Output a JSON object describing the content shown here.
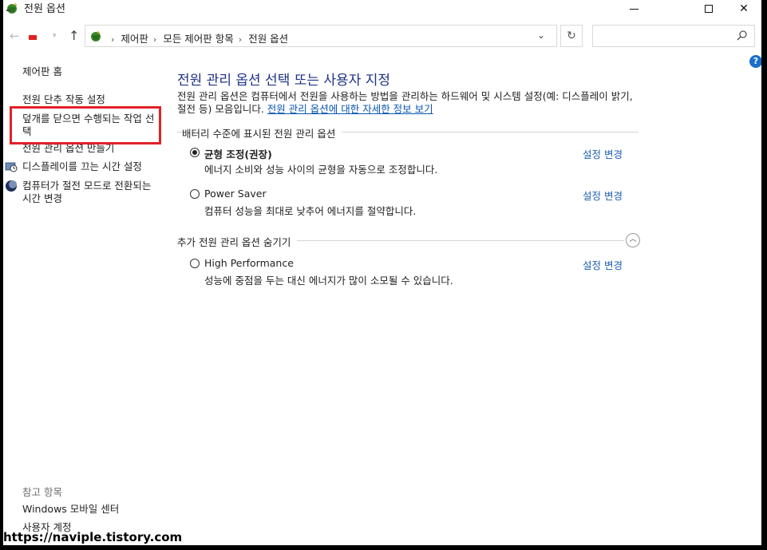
{
  "window": {
    "title": "전원 옵션"
  },
  "address_bar": {
    "crumbs": [
      "제어판",
      "모든 제어판 항목",
      "전원 옵션"
    ],
    "search_placeholder": ""
  },
  "sidebar": {
    "home": "제어판 홈",
    "power_button": "전원 단추 작동 설정",
    "lid_close": "덮개를 닫으면 수행되는 작업 선택",
    "create_plan": "전원 관리 옵션 만들기",
    "display_off": "디스플레이를 끄는 시간 설정",
    "sleep_change": "컴퓨터가 절전 모드로 전환되는 시간 변경",
    "see_also": "참고 항목",
    "mobility_center": "Windows 모바일 센터",
    "user_accounts": "사용자 계정"
  },
  "main": {
    "title": "전원 관리 옵션 선택 또는 사용자 지정",
    "description": "전원 관리 옵션은 컴퓨터에서 전원을 사용하는 방법을 관리하는 하드웨어 및 시스템 설정(예: 디스플레이 밝기, 절전 등) 모음입니다.",
    "more_info_link": "전원 관리 옵션에 대한 자세한 정보 보기",
    "battery_group": "배터리 수준에 표시된 전원 관리 옵션",
    "hidden_group": "추가 전원 관리 옵션 숨기기",
    "change_label": "설정 변경",
    "plans": [
      {
        "name": "균형 조정(권장)",
        "desc": "에너지 소비와 성능 사이의 균형을 자동으로 조정합니다.",
        "selected": true
      },
      {
        "name": "Power Saver",
        "desc": "컴퓨터 성능을 최대로 낮추어 에너지를 절약합니다.",
        "selected": false
      },
      {
        "name": "High Performance",
        "desc": "성능에 중점을 두는 대신 에너지가 많이 소모될 수 있습니다.",
        "selected": false
      }
    ]
  },
  "watermark": "https://naviple.tistory.com",
  "colors": {
    "title_blue": "#1e3287",
    "link_blue": "#1e5fb0",
    "highlight_red": "#e2212a"
  }
}
